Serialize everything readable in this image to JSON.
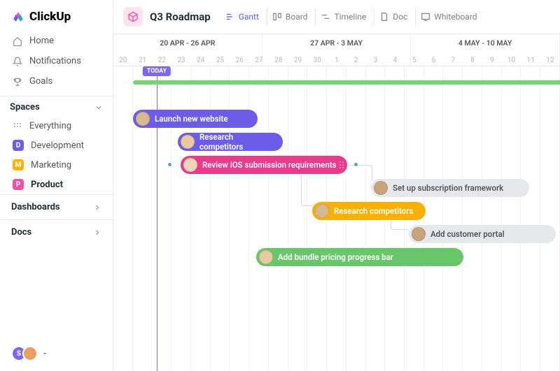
{
  "brand": "ClickUp",
  "nav": {
    "home": "Home",
    "notifications": "Notifications",
    "goals": "Goals"
  },
  "spacesHeader": "Spaces",
  "spaces": {
    "everything": "Everything",
    "dev": {
      "letter": "D",
      "label": "Development",
      "color": "#6c5ce7"
    },
    "mkt": {
      "letter": "M",
      "label": "Marketing",
      "color": "#ffb300"
    },
    "prod": {
      "letter": "P",
      "label": "Product",
      "color": "#ff4da6"
    }
  },
  "dashboards": "Dashboards",
  "docs": "Docs",
  "project": "Q3 Roadmap",
  "views": {
    "gantt": "Gantt",
    "board": "Board",
    "timeline": "Timeline",
    "doc": "Doc",
    "whiteboard": "Whiteboard"
  },
  "weeks": [
    "20 APR - 26 APR",
    "27 APR - 3 MAY",
    "4 MAY - 10 MAY"
  ],
  "days": [
    "20",
    "21",
    "22",
    "23",
    "24",
    "25",
    "26",
    "27",
    "28",
    "29",
    "30",
    "1",
    "2",
    "3",
    "4",
    "5",
    "6",
    "7",
    "8",
    "9",
    "10",
    "11",
    "12"
  ],
  "today": "TODAY",
  "tasks": {
    "t1": "Launch new website",
    "t2": "Research competitors",
    "t3": "Review iOS submission requirements",
    "t4": "Set up subscription framework",
    "t5": "Research competitors",
    "t6": "Add customer portal",
    "t7": "Add bundle pricing progress bar"
  },
  "colors": {
    "purple": "#6c5ce7",
    "pink": "#ea3a8c",
    "yellow": "#f9b100",
    "grey": "#e6e8eb",
    "green": "#6ac66a",
    "greenL": "#73d673"
  }
}
